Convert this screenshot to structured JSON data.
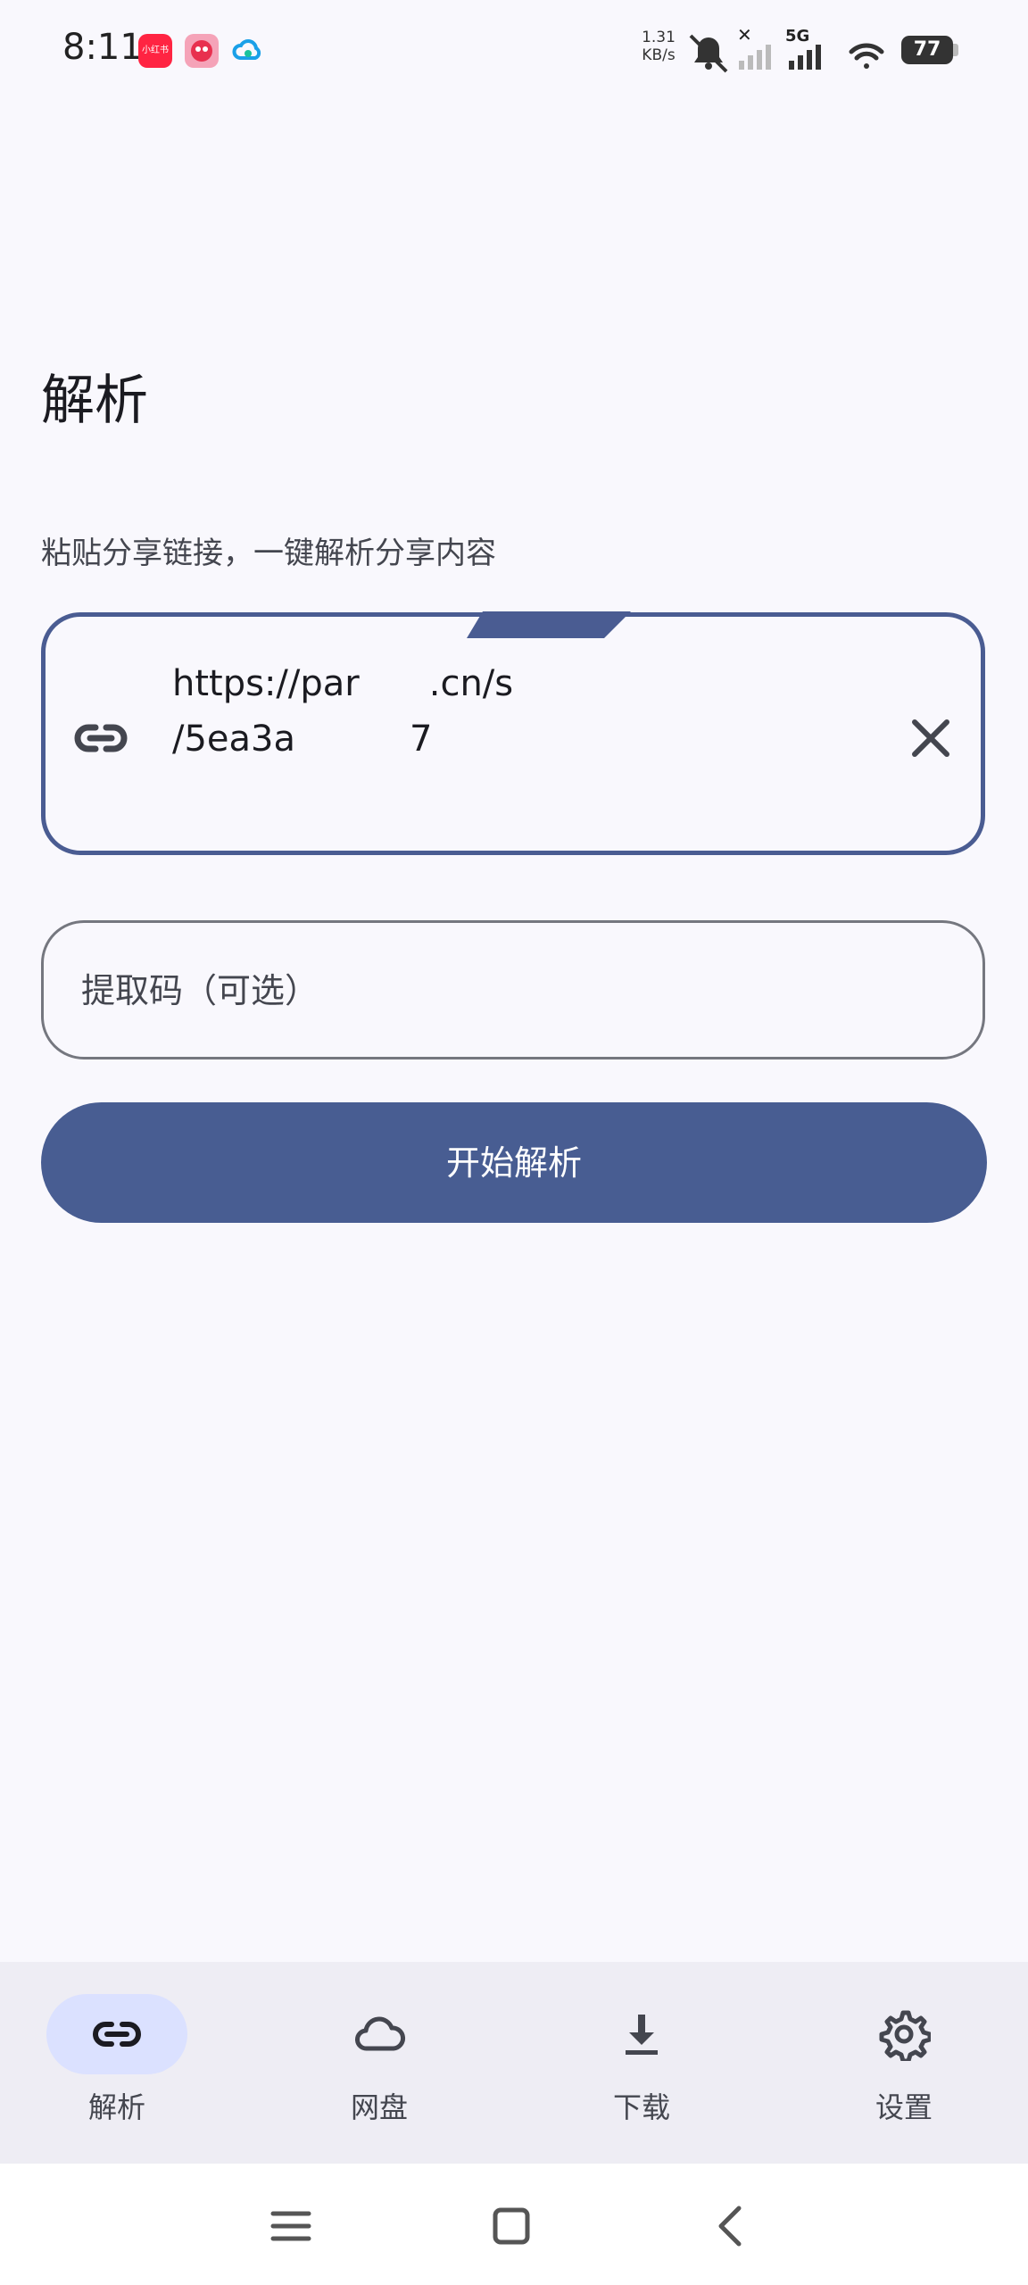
{
  "status_bar": {
    "time": "8:11",
    "net_speed_value": "1.31",
    "net_speed_unit": "KB/s",
    "network_type": "5G",
    "battery": "77",
    "notification_apps": [
      "小红书",
      "app-icon-2",
      "cloud-app-icon"
    ]
  },
  "page": {
    "title": "解析",
    "subtitle": "粘贴分享链接，一键解析分享内容"
  },
  "url_input": {
    "value_line1_a": "https://par",
    "value_line1_b": ".cn/s",
    "value_line2_a": "/5ea3a",
    "value_line2_b": "7"
  },
  "code_input": {
    "placeholder": "提取码（可选）",
    "value": ""
  },
  "start_button": {
    "label": "开始解析"
  },
  "bottom_nav": {
    "items": [
      {
        "label": "解析",
        "icon": "link-icon",
        "active": true
      },
      {
        "label": "网盘",
        "icon": "cloud-icon",
        "active": false
      },
      {
        "label": "下载",
        "icon": "download-icon",
        "active": false
      },
      {
        "label": "设置",
        "icon": "gear-icon",
        "active": false
      }
    ]
  },
  "colors": {
    "primary": "#485d92",
    "background": "#f9f8fd",
    "nav_background": "#eeedf4",
    "active_pill": "#dbe1ff"
  }
}
